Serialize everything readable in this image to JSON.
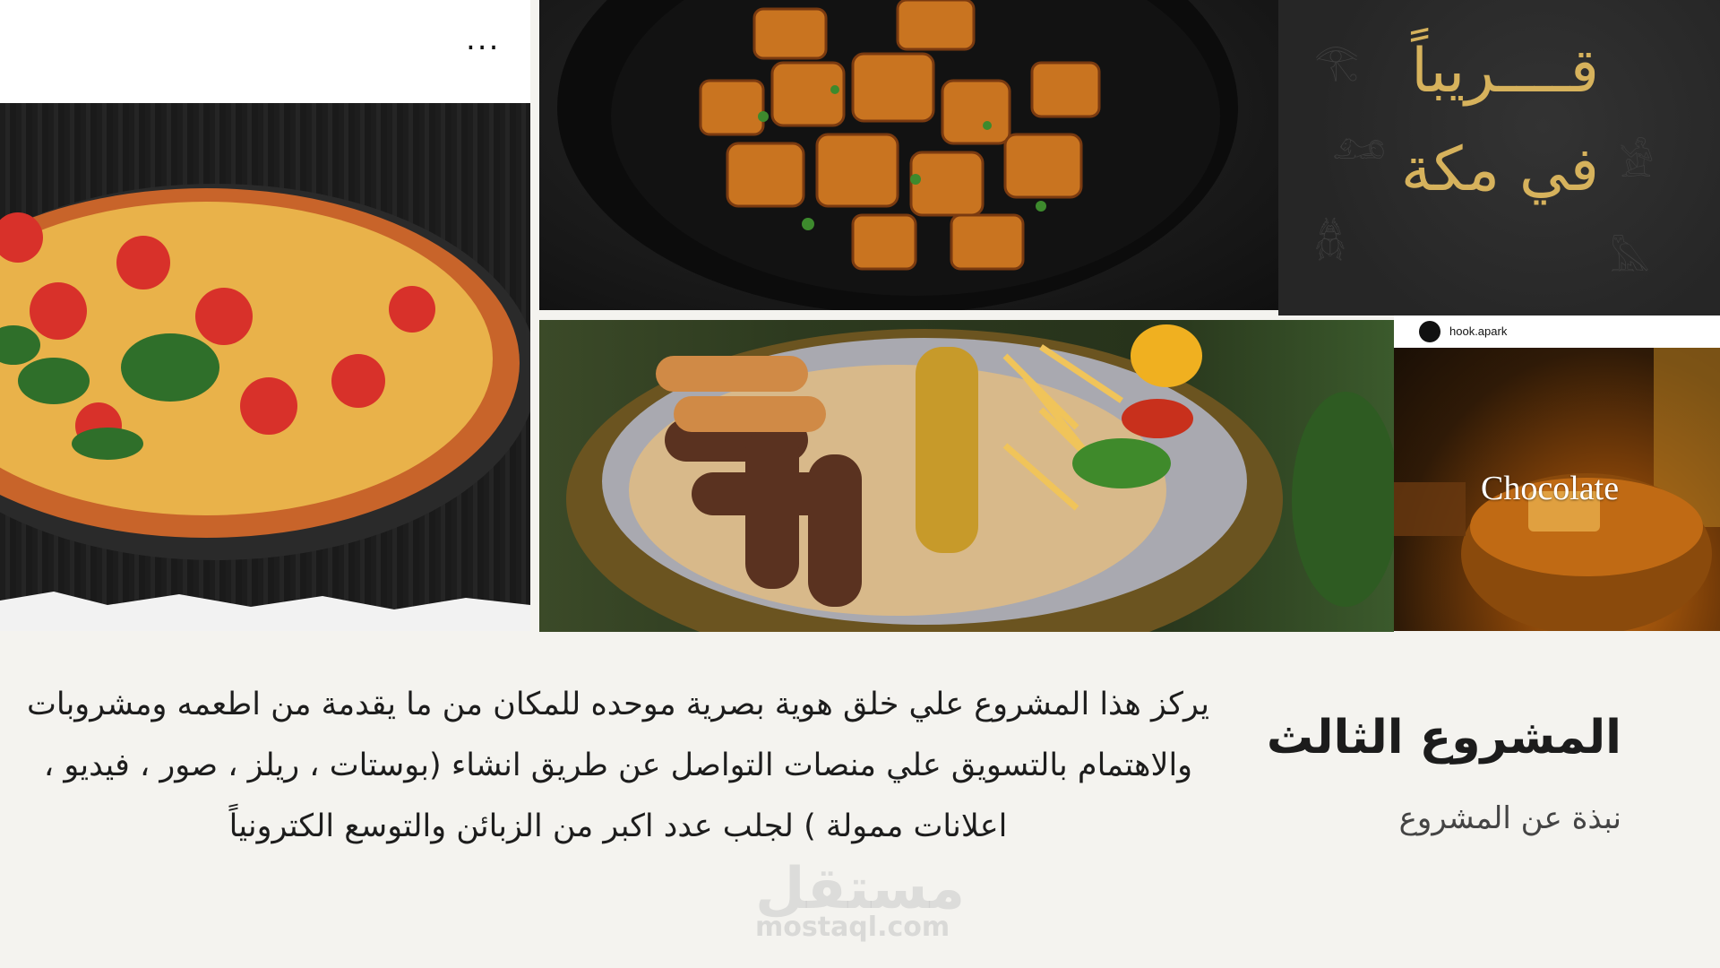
{
  "pizza_post": {
    "more_label": "..."
  },
  "coming_soon": {
    "line1": "قــــريباً",
    "line2": "في مكة"
  },
  "chocolate_post": {
    "handle": "hook.apark",
    "title": "Chocolate"
  },
  "project": {
    "title": "المشروع الثالث",
    "subtitle": "نبذة عن المشروع",
    "description": "يركز هذا المشروع علي خلق هوية بصرية موحده للمكان من ما يقدمة من اطعمه ومشروبات والاهتمام بالتسويق علي منصات التواصل عن طريق انشاء (بوستات ، ريلز ، صور ، فيديو ، اعلانات ممولة ) لجلب عدد اكبر من الزبائن والتوسع الكترونياً"
  },
  "watermark": {
    "logo": "مستقل",
    "url": "mostaql.com"
  },
  "colors": {
    "background": "#f4f3ef",
    "gold_text": "#d6b25c",
    "heading": "#1c1c1c"
  },
  "icons": [
    "more-icon",
    "avatar-icon"
  ]
}
